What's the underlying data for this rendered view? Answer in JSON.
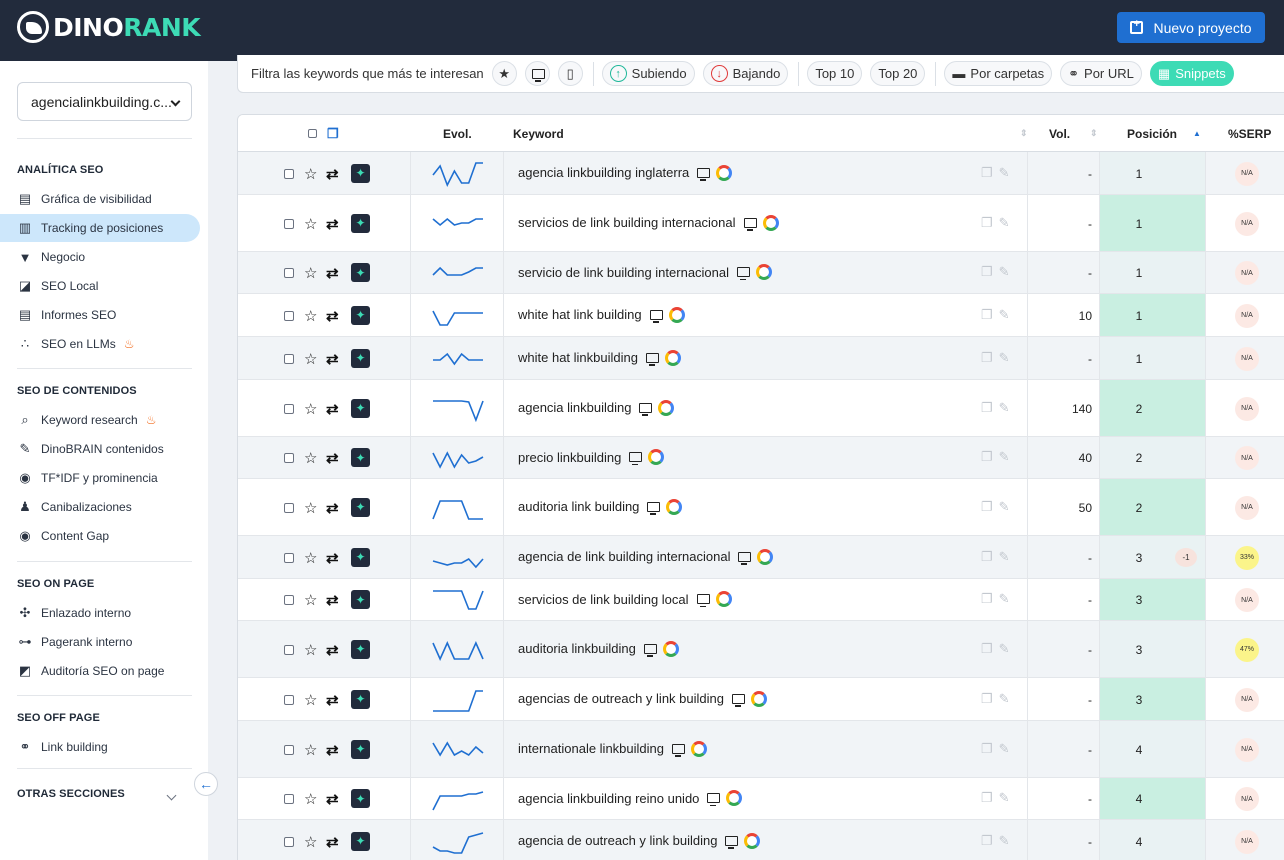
{
  "app": {
    "logo_left": "DINO",
    "logo_right": "RANK",
    "new_project_label": "Nuevo proyecto"
  },
  "sidebar": {
    "project": "agencialinkbuilding.c...",
    "sections": [
      {
        "title": "ANALÍTICA SEO",
        "items": [
          {
            "label": "Gráfica de visibilidad",
            "icon": "report-icon"
          },
          {
            "label": "Tracking de posiciones",
            "icon": "bar-chart-icon",
            "active": true
          },
          {
            "label": "Negocio",
            "icon": "funnel-icon"
          },
          {
            "label": "SEO Local",
            "icon": "map-icon"
          },
          {
            "label": "Informes SEO",
            "icon": "pdf-icon"
          },
          {
            "label": "SEO en LLMs",
            "icon": "dots-icon",
            "fire": true
          }
        ]
      },
      {
        "title": "SEO DE CONTENIDOS",
        "items": [
          {
            "label": "Keyword research",
            "icon": "keyword-research-icon",
            "fire": true
          },
          {
            "label": "DinoBRAIN contenidos",
            "icon": "pen-icon"
          },
          {
            "label": "TF*IDF y prominencia",
            "icon": "target-icon"
          },
          {
            "label": "Canibalizaciones",
            "icon": "cannibal-icon"
          },
          {
            "label": "Content Gap",
            "icon": "eye-icon"
          }
        ]
      },
      {
        "title": "SEO ON PAGE",
        "items": [
          {
            "label": "Enlazado interno",
            "icon": "network-icon"
          },
          {
            "label": "Pagerank interno",
            "icon": "hierarchy-icon"
          },
          {
            "label": "Auditoría SEO on page",
            "icon": "audit-icon"
          }
        ]
      },
      {
        "title": "SEO OFF PAGE",
        "items": [
          {
            "label": "Link building",
            "icon": "link-icon"
          }
        ]
      },
      {
        "title": "OTRAS SECCIONES",
        "items": []
      }
    ]
  },
  "filterbar": {
    "label": "Filtra las keywords que más te interesan",
    "subiendo": "Subiendo",
    "bajando": "Bajando",
    "top10": "Top 10",
    "top20": "Top 20",
    "carpetas": "Por carpetas",
    "url": "Por URL",
    "snippets": "Snippets"
  },
  "table": {
    "headers": {
      "evol": "Evol.",
      "keyword": "Keyword",
      "vol": "Vol.",
      "pos": "Posición",
      "serp": "%SERP"
    },
    "rows": [
      {
        "keyword": "agencia linkbuilding inglaterra",
        "vol": "-",
        "pos": "1",
        "change": "",
        "serp": "N/A",
        "trend": [
          12,
          3,
          22,
          8,
          20,
          20,
          0,
          0
        ]
      },
      {
        "keyword": "servicios de link building internacional",
        "vol": "-",
        "pos": "1",
        "change": "",
        "serp": "N/A",
        "trend": [
          6,
          12,
          6,
          12,
          10,
          10,
          6,
          6
        ]
      },
      {
        "keyword": "servicio de link building internacional",
        "vol": "-",
        "pos": "1",
        "change": "",
        "serp": "N/A",
        "trend": [
          13,
          6,
          13,
          13,
          13,
          10,
          6,
          6
        ]
      },
      {
        "keyword": "white hat link building",
        "vol": "10",
        "pos": "1",
        "change": "",
        "serp": "N/A",
        "trend": [
          6,
          20,
          20,
          8,
          8,
          8,
          8,
          8
        ]
      },
      {
        "keyword": "white hat linkbuilding",
        "vol": "-",
        "pos": "1",
        "change": "",
        "serp": "N/A",
        "trend": [
          12,
          12,
          6,
          16,
          6,
          12,
          12,
          12
        ]
      },
      {
        "keyword": "agencia linkbuilding",
        "vol": "140",
        "pos": "2",
        "change": "",
        "serp": "N/A",
        "trend": [
          3,
          3,
          3,
          3,
          3,
          4,
          22,
          3
        ]
      },
      {
        "keyword": "precio linkbuilding",
        "vol": "40",
        "pos": "2",
        "change": "",
        "serp": "N/A",
        "trend": [
          6,
          20,
          6,
          20,
          8,
          16,
          14,
          10
        ]
      },
      {
        "keyword": "auditoria link building",
        "vol": "50",
        "pos": "2",
        "change": "",
        "serp": "N/A",
        "trend": [
          22,
          4,
          4,
          4,
          4,
          22,
          22,
          22
        ]
      },
      {
        "keyword": "agencia de link building internacional",
        "vol": "-",
        "pos": "3",
        "change": "-1",
        "serp": "33%",
        "trend": [
          14,
          16,
          18,
          16,
          16,
          12,
          20,
          12
        ]
      },
      {
        "keyword": "servicios de link building local",
        "vol": "-",
        "pos": "3",
        "change": "",
        "serp": "N/A",
        "trend": [
          2,
          2,
          2,
          2,
          2,
          20,
          20,
          2
        ]
      },
      {
        "keyword": "auditoria linkbuilding",
        "vol": "-",
        "pos": "3",
        "change": "",
        "serp": "47%",
        "trend": [
          4,
          20,
          4,
          20,
          20,
          20,
          4,
          20
        ]
      },
      {
        "keyword": "agencias de outreach y link building",
        "vol": "-",
        "pos": "3",
        "change": "",
        "serp": "N/A",
        "trend": [
          22,
          22,
          22,
          22,
          22,
          22,
          2,
          2
        ]
      },
      {
        "keyword": "internationale linkbuilding",
        "vol": "-",
        "pos": "4",
        "change": "",
        "serp": "N/A",
        "trend": [
          4,
          16,
          4,
          16,
          12,
          16,
          8,
          14
        ]
      },
      {
        "keyword": "agencia linkbuilding reino unido",
        "vol": "-",
        "pos": "4",
        "change": "",
        "serp": "N/A",
        "trend": [
          22,
          8,
          8,
          8,
          8,
          6,
          6,
          4
        ]
      },
      {
        "keyword": "agencia de outreach y link building",
        "vol": "-",
        "pos": "4",
        "change": "",
        "serp": "N/A",
        "trend": [
          16,
          20,
          20,
          22,
          22,
          6,
          4,
          2
        ]
      }
    ]
  }
}
